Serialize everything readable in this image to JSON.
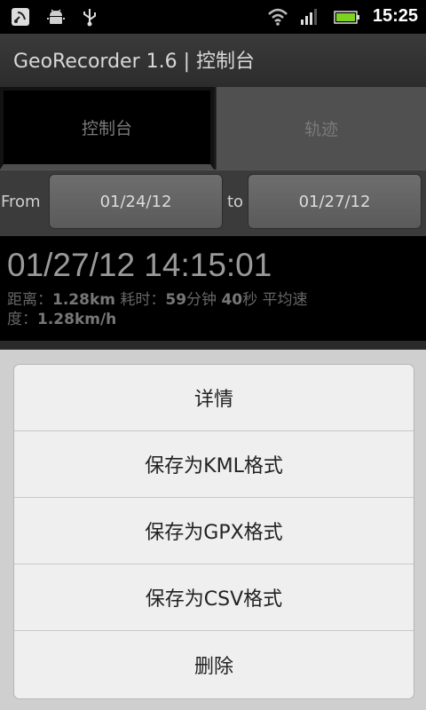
{
  "status_bar": {
    "time": "15:25",
    "icons": [
      "satellite-icon",
      "android-debug-icon",
      "usb-icon",
      "wifi-icon",
      "signal-icon",
      "battery-icon"
    ]
  },
  "app": {
    "title": "GeoRecorder 1.6 | 控制台"
  },
  "tabs": [
    {
      "label": "控制台"
    },
    {
      "label": "轨迹"
    }
  ],
  "filter": {
    "from_label": "From",
    "from_date": "01/24/12",
    "to_label": "to",
    "to_date": "01/27/12"
  },
  "track": {
    "datetime": "01/27/12 14:15:01",
    "distance_label": "距离：",
    "distance_value": "1.28km",
    "duration_label": "耗时：",
    "duration_min": "59",
    "duration_min_unit": "分钟",
    "duration_sec": "40",
    "duration_sec_unit": "秒",
    "speed_label_a": "平均速",
    "speed_label_b": "度：",
    "speed_value": "1.28km/h"
  },
  "context_menu": {
    "items": [
      {
        "label": "详情"
      },
      {
        "label": "保存为KML格式"
      },
      {
        "label": "保存为GPX格式"
      },
      {
        "label": "保存为CSV格式"
      },
      {
        "label": "删除"
      }
    ]
  },
  "colors": {
    "background": "#000000",
    "dialog": "#efefef",
    "battery": "#7ed321"
  }
}
